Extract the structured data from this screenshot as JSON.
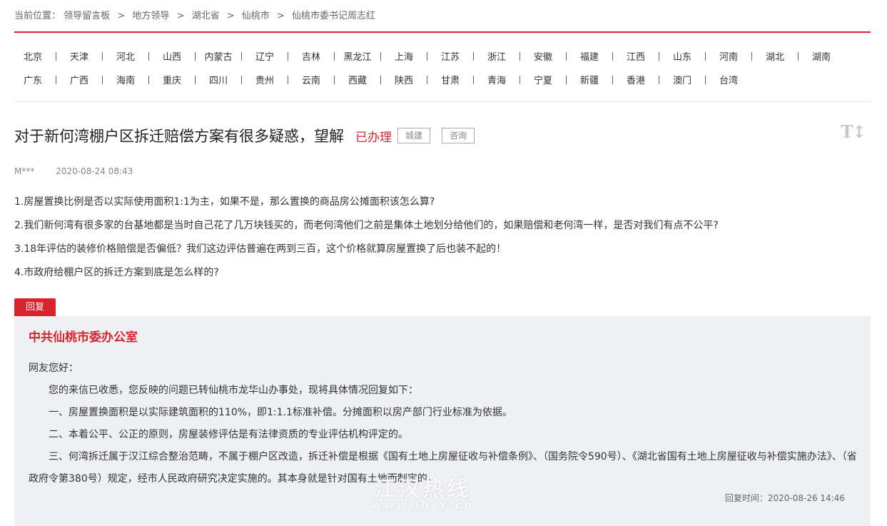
{
  "breadcrumb": {
    "label": "当前位置：",
    "items": [
      "领导留言板",
      "地方领导",
      "湖北省",
      "仙桃市",
      "仙桃市委书记周志红"
    ],
    "separator": ">"
  },
  "regions": {
    "row1": [
      "北京",
      "天津",
      "河北",
      "山西",
      "内蒙古",
      "辽宁",
      "吉林",
      "黑龙江",
      "上海",
      "江苏",
      "浙江",
      "安徽",
      "福建",
      "江西",
      "山东",
      "河南",
      "湖北",
      "湖南"
    ],
    "row2": [
      "广东",
      "广西",
      "海南",
      "重庆",
      "四川",
      "贵州",
      "云南",
      "西藏",
      "陕西",
      "甘肃",
      "青海",
      "宁夏",
      "新疆",
      "香港",
      "澳门",
      "台湾"
    ]
  },
  "message": {
    "title": "对于新何湾棚户区拆迁赔偿方案有很多疑惑，望解",
    "status": "已办理",
    "tags": [
      "城建",
      "咨询"
    ],
    "author": "M***",
    "date": "2020-08-24 08:43",
    "font_tool_icon": "font-size-icon",
    "paragraphs": [
      "1.房屋置换比例是否以实际使用面积1:1为主，如果不是，那么置换的商品房公摊面积该怎么算?",
      "2.我们新何湾有很多家的台基地都是当时自己花了几万块钱买的，而老何湾他们之前是集体土地划分给他们的，如果赔偿和老何湾一样，是否对我们有点不公平?",
      "3.18年评估的装修价格赔偿是否偏低？我们这边评估普遍在两到三百，这个价格就算房屋置换了后也装不起的！",
      "4.市政府给棚户区的拆迁方案到底是怎么样的?"
    ]
  },
  "reply": {
    "tab_label": "回复",
    "org": "中共仙桃市委办公室",
    "greeting": "网友您好：",
    "paragraphs": [
      "您的来信已收悉，您反映的问题已转仙桃市龙华山办事处，现将具体情况回复如下：",
      "一、房屋置换面积是以实际建筑面积的110%，即1:1.1标准补偿。分摊面积以房产部门行业标准为依据。",
      "二、本着公平、公正的原则，房屋装修评估是有法律资质的专业评估机构评定的。",
      "三、何湾拆迁属于汉江综合整治范畴，不属于棚户区改造，拆迁补偿是根据《国有土地上房屋征收与补偿条例》、（国务院令590号）、《湖北省国有土地上房屋征收与补偿实施办法》、（省政府令第380号）规定，经市人民政府研究决定实施的。其本身就是针对国有土地而制定的。"
    ],
    "time_label": "回复时间：",
    "time": "2020-08-26 14:46"
  },
  "watermark": {
    "line1": "江汉热线",
    "line2": "www.jhrx.cn"
  },
  "colors": {
    "accent": "#d9232f",
    "reply_bg": "#eef0f4"
  }
}
